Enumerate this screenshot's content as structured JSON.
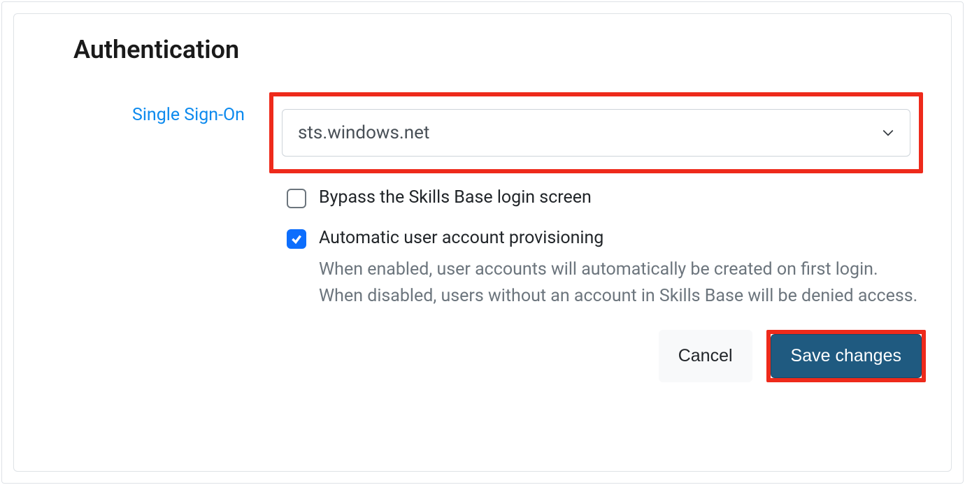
{
  "section": {
    "title": "Authentication"
  },
  "sso": {
    "label": "Single Sign-On",
    "selected": "sts.windows.net"
  },
  "bypass": {
    "label": "Bypass the Skills Base login screen",
    "checked": false
  },
  "autoprov": {
    "label": "Automatic user account provisioning",
    "help": "When enabled, user accounts will automatically be created on first login. When disabled, users without an account in Skills Base will be denied access.",
    "checked": true
  },
  "buttons": {
    "cancel": "Cancel",
    "save": "Save changes"
  }
}
